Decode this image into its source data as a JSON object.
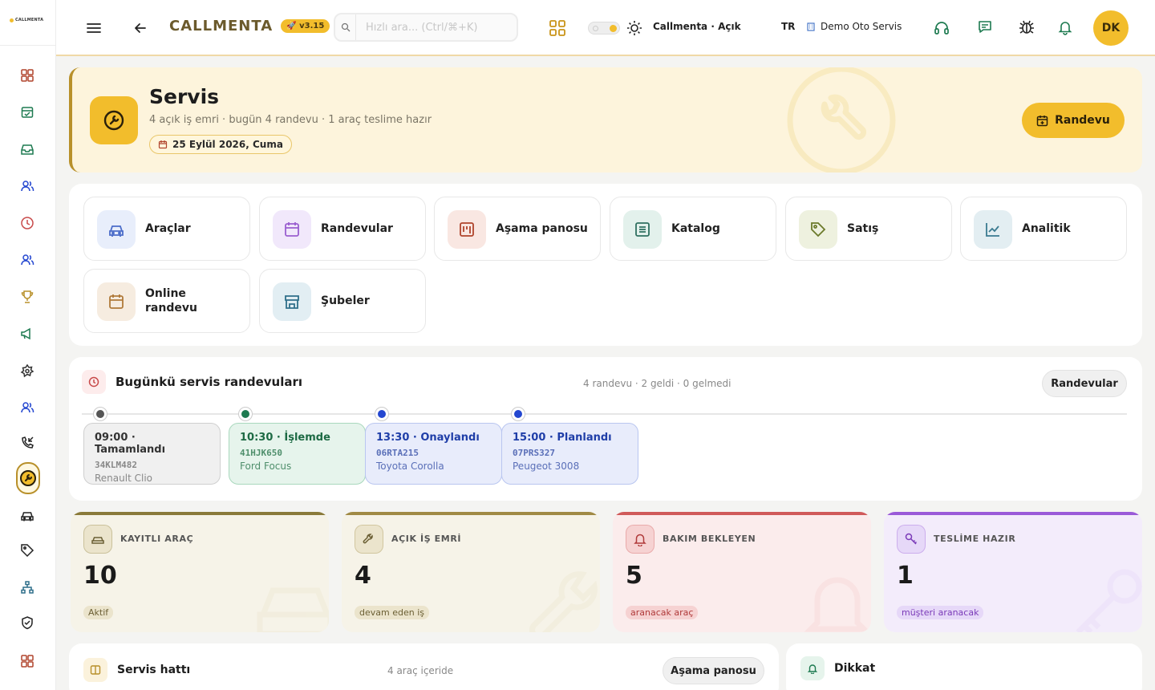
{
  "app": {
    "logo_text": "CALLMENTA",
    "brand": "CALLMENTA",
    "version": "v3.15",
    "search_placeholder": "Hızlı ara... (Ctrl/⌘+K)",
    "status": "Callmenta · Açık",
    "lang": "TR",
    "org": "Demo Oto Servis",
    "user_initials": "DK",
    "accent": "#f2bd2c"
  },
  "sidebar": {
    "items": [
      {
        "icon": "dashboard-icon"
      },
      {
        "icon": "calendar-check-icon"
      },
      {
        "icon": "inbox-icon"
      },
      {
        "icon": "users-icon"
      },
      {
        "icon": "clock-icon"
      },
      {
        "icon": "contacts-icon"
      },
      {
        "icon": "trophy-icon"
      },
      {
        "icon": "megaphone-icon"
      },
      {
        "icon": "ai-icon"
      },
      {
        "icon": "team-icon"
      },
      {
        "icon": "phone-incoming-icon"
      },
      {
        "icon": "service-icon",
        "active": true
      },
      {
        "icon": "car-icon"
      },
      {
        "icon": "tag-icon"
      },
      {
        "icon": "org-chart-icon"
      },
      {
        "icon": "shield-icon"
      },
      {
        "icon": "grid-icon"
      }
    ]
  },
  "hero": {
    "title": "Servis",
    "subtitle": "4 açık iş emri · bugün 4 randevu · 1 araç teslime hazır",
    "date": "25 Eylül 2026, Cuma",
    "button": "Randevu"
  },
  "quicklinks": [
    {
      "label": "Araçlar",
      "icon": "car-icon",
      "color": "#4a6cc9",
      "bg": "#e8eefb"
    },
    {
      "label": "Randevular",
      "icon": "calendar-icon",
      "color": "#9a5fd0",
      "bg": "#f1e8fb"
    },
    {
      "label": "Aşama panosu",
      "icon": "kanban-icon",
      "color": "#b0442c",
      "bg": "#f9e7e2"
    },
    {
      "label": "Katalog",
      "icon": "list-icon",
      "color": "#2f7060",
      "bg": "#e3f1ec"
    },
    {
      "label": "Satış",
      "icon": "tag-icon",
      "color": "#6b7a2a",
      "bg": "#eef1df"
    },
    {
      "label": "Analitik",
      "icon": "chart-icon",
      "color": "#3a7a90",
      "bg": "#e3eef2"
    },
    {
      "label": "Online randevu",
      "icon": "calendar-icon",
      "color": "#b07a3a",
      "bg": "#f6ece0"
    },
    {
      "label": "Şubeler",
      "icon": "store-icon",
      "color": "#2f6f8a",
      "bg": "#e2eef3"
    }
  ],
  "appointments": {
    "title": "Bugünkü servis randevuları",
    "stats": "4 randevu · 2 geldi · 0 gelmedi",
    "button": "Randevular",
    "items": [
      {
        "time_status": "09:00 · Tamamlandı",
        "plate": "34KLM482",
        "model": "Renault Clio",
        "dot": "#555555",
        "bg": "#f0f0f0",
        "border": "#cfcfcf",
        "fg": "#333333",
        "sub": "#888888"
      },
      {
        "time_status": "10:30 · İşlemde",
        "plate": "41HJK650",
        "model": "Ford Focus",
        "dot": "#1d7a50",
        "bg": "#e6f4ec",
        "border": "#a9d8bd",
        "fg": "#1d6a44",
        "sub": "#4f8f6c"
      },
      {
        "time_status": "13:30 · Onaylandı",
        "plate": "06RTA215",
        "model": "Toyota Corolla",
        "dot": "#2447d0",
        "bg": "#e8ecfb",
        "border": "#b9c6f0",
        "fg": "#1f3ea8",
        "sub": "#5a6fb8"
      },
      {
        "time_status": "15:00 · Planlandı",
        "plate": "07PRS327",
        "model": "Peugeot 3008",
        "dot": "#2447d0",
        "bg": "#e8ecfb",
        "border": "#b9c6f0",
        "fg": "#1f3ea8",
        "sub": "#5a6fb8"
      }
    ]
  },
  "kpis": [
    {
      "label": "KAYITLI ARAÇ",
      "value": "10",
      "badge": "Aktif",
      "icon": "car-icon",
      "accent": "#8a7a3a",
      "bg": "#f6f3e8",
      "badge_bg": "#ebe4cc",
      "badge_fg": "#6b5f34"
    },
    {
      "label": "AÇIK İŞ EMRİ",
      "value": "4",
      "badge": "devam eden iş",
      "icon": "wrench-icon",
      "accent": "#a08a45",
      "bg": "#f6f3e8",
      "badge_bg": "#ebe4cc",
      "badge_fg": "#6b5f34"
    },
    {
      "label": "BAKIM BEKLEYEN",
      "value": "5",
      "badge": "aranacak araç",
      "icon": "bell-icon",
      "accent": "#d05a5a",
      "bg": "#fbecec",
      "badge_bg": "#f6d2d2",
      "badge_fg": "#b03a3a"
    },
    {
      "label": "TESLİME HAZIR",
      "value": "1",
      "badge": "müşteri aranacak",
      "icon": "key-icon",
      "accent": "#9a5ad8",
      "bg": "#f3ecfb",
      "badge_bg": "#e6d8f8",
      "badge_fg": "#7a3ab8"
    }
  ],
  "pipeline": {
    "title": "Servis hattı",
    "stats": "4 araç içeride",
    "button": "Aşama panosu"
  },
  "attention": {
    "title": "Dikkat"
  }
}
